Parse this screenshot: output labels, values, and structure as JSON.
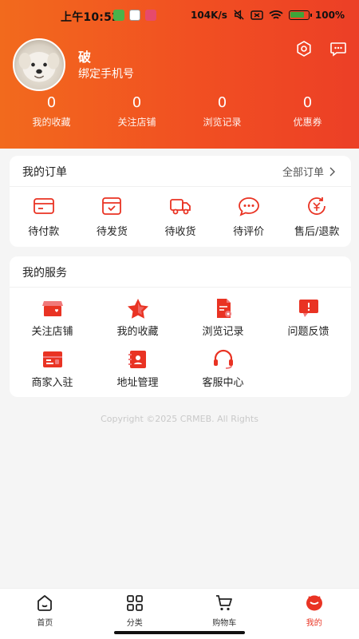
{
  "status_bar": {
    "time": "上午10:52",
    "network_speed": "104K/s",
    "battery": "100%"
  },
  "profile": {
    "username": "破",
    "bind_phone": "绑定手机号"
  },
  "stats": [
    {
      "value": "0",
      "label": "我的收藏"
    },
    {
      "value": "0",
      "label": "关注店铺"
    },
    {
      "value": "0",
      "label": "浏览记录"
    },
    {
      "value": "0",
      "label": "优惠券"
    }
  ],
  "orders": {
    "title": "我的订单",
    "more_label": "全部订单",
    "items": [
      {
        "label": "待付款",
        "icon": "wallet-icon"
      },
      {
        "label": "待发货",
        "icon": "package-icon"
      },
      {
        "label": "待收货",
        "icon": "truck-icon"
      },
      {
        "label": "待评价",
        "icon": "comment-icon"
      },
      {
        "label": "售后/退款",
        "icon": "refund-icon"
      }
    ]
  },
  "services": {
    "title": "我的服务",
    "items": [
      {
        "label": "关注店铺",
        "icon": "store-icon"
      },
      {
        "label": "我的收藏",
        "icon": "star-icon"
      },
      {
        "label": "浏览记录",
        "icon": "history-icon"
      },
      {
        "label": "问题反馈",
        "icon": "feedback-icon"
      },
      {
        "label": "商家入驻",
        "icon": "merchant-icon"
      },
      {
        "label": "地址管理",
        "icon": "address-icon"
      },
      {
        "label": "客服中心",
        "icon": "headset-icon"
      }
    ]
  },
  "copyright": "Copyright ©2025 CRMEB. All Rights",
  "tabbar": [
    {
      "label": "首页",
      "icon": "home-icon"
    },
    {
      "label": "分类",
      "icon": "category-icon"
    },
    {
      "label": "购物车",
      "icon": "cart-icon"
    },
    {
      "label": "我的",
      "icon": "user-icon",
      "active": true
    }
  ],
  "colors": {
    "accent": "#e93323",
    "header_start": "#f26a1d",
    "header_end": "#ec3f26"
  }
}
